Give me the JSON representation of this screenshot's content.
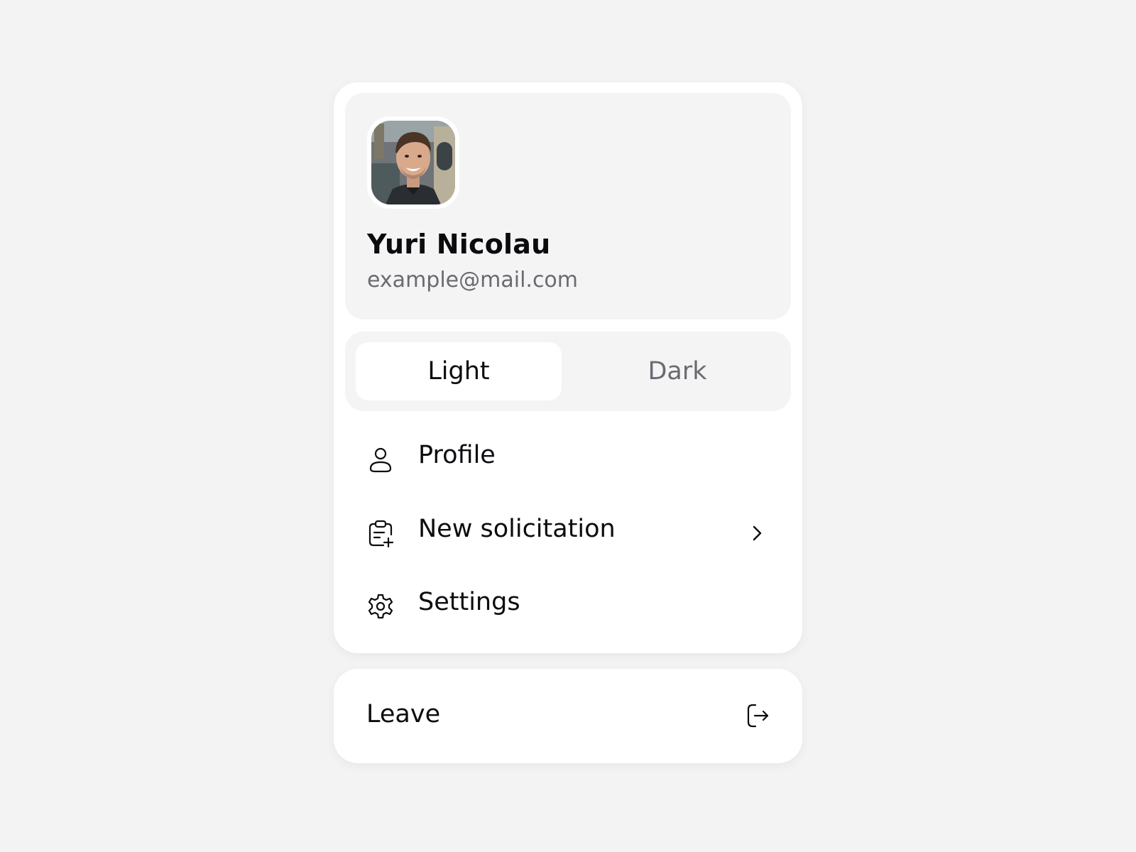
{
  "user": {
    "name": "Yuri Nicolau",
    "email": "example@mail.com",
    "avatar_alt": "avatar"
  },
  "theme": {
    "options": [
      {
        "label": "Light",
        "active": true
      },
      {
        "label": "Dark",
        "active": false
      }
    ]
  },
  "menu": {
    "items": [
      {
        "label": "Profile",
        "icon": "user-icon",
        "has_submenu": false
      },
      {
        "label": "New solicitation",
        "icon": "clipboard-plus-icon",
        "has_submenu": true
      },
      {
        "label": "Settings",
        "icon": "gear-icon",
        "has_submenu": false
      }
    ]
  },
  "leave": {
    "label": "Leave",
    "icon": "logout-icon"
  },
  "colors": {
    "background": "#f3f3f3",
    "card": "#ffffff",
    "panel": "#f4f4f4",
    "text_primary": "#0c0c10",
    "text_secondary": "#6b6a72"
  }
}
